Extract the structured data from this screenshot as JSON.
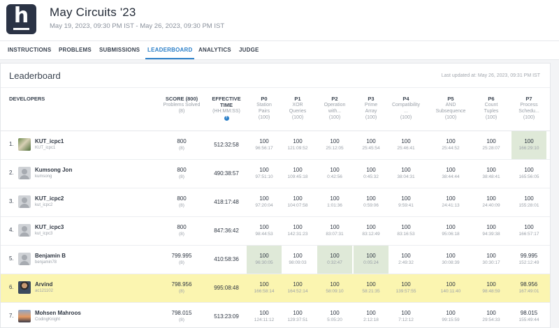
{
  "contest": {
    "logo_letter": "h",
    "title": "May Circuits '23",
    "dates": "May 19, 2023, 09:30 PM IST - May 26, 2023, 09:30 PM IST"
  },
  "tabs": [
    "INSTRUCTIONS",
    "PROBLEMS",
    "SUBMISSIONS",
    "LEADERBOARD",
    "ANALYTICS",
    "JUDGE"
  ],
  "active_tab": "LEADERBOARD",
  "leaderboard": {
    "title": "Leaderboard",
    "updated": "Last updated at: May 26, 2023, 09:31 PM IST",
    "developers_header": "DEVELOPERS",
    "score_header": {
      "title": "SCORE (800)",
      "sub": "Problems Solved",
      "sub2": "(8)"
    },
    "eff_header": {
      "title1": "EFFECTIVE",
      "title2": "TIME",
      "sub": "(HH:MM:SS)"
    },
    "problems": [
      {
        "code": "P0",
        "l1": "Station",
        "l2": "Pairs",
        "max": "(100)"
      },
      {
        "code": "P1",
        "l1": "XOR",
        "l2": "Queries",
        "max": "(100)"
      },
      {
        "code": "P2",
        "l1": "Operation",
        "l2": "with...",
        "max": "(100)"
      },
      {
        "code": "P3",
        "l1": "Prime",
        "l2": "Array",
        "max": "(100)"
      },
      {
        "code": "P4",
        "l1": "Compatibility",
        "l2": "...",
        "max": "(100)"
      },
      {
        "code": "P5",
        "l1": "AND",
        "l2": "Subsequence",
        "max": "(100)"
      },
      {
        "code": "P6",
        "l1": "Count",
        "l2": "Tuples",
        "max": "(100)"
      },
      {
        "code": "P7",
        "l1": "Process",
        "l2": "Schedu...",
        "max": "(100)"
      }
    ],
    "rows": [
      {
        "rank": "1.",
        "name": "KUT_icpc1",
        "handle": "KUT_icpc1",
        "avatar": "img1",
        "score": "800",
        "solved": "(8)",
        "eff": "512:32:58",
        "cells": [
          [
            "100",
            "96:56:17"
          ],
          [
            "100",
            "121:09:52"
          ],
          [
            "100",
            "25:12:05"
          ],
          [
            "100",
            "25:45:54"
          ],
          [
            "100",
            "25:46:41"
          ],
          [
            "100",
            "25:44:52"
          ],
          [
            "100",
            "25:28:07"
          ],
          [
            "100",
            "166:29:10"
          ]
        ],
        "first": [
          7
        ],
        "highlight": false
      },
      {
        "rank": "2.",
        "name": "Kumsong Jon",
        "handle": "kumsong",
        "avatar": "default",
        "score": "800",
        "solved": "(8)",
        "eff": "490:38:57",
        "cells": [
          [
            "100",
            "97:51:10"
          ],
          [
            "100",
            "109:45:18"
          ],
          [
            "100",
            "0:42:56"
          ],
          [
            "100",
            "0:45:32"
          ],
          [
            "100",
            "38:04:31"
          ],
          [
            "100",
            "38:44:44"
          ],
          [
            "100",
            "38:48:41"
          ],
          [
            "100",
            "165:56:05"
          ]
        ],
        "first": [],
        "highlight": false
      },
      {
        "rank": "3.",
        "name": "KUT_icpc2",
        "handle": "kut_icpc2",
        "avatar": "default",
        "score": "800",
        "solved": "(8)",
        "eff": "418:17:48",
        "cells": [
          [
            "100",
            "97:20:04"
          ],
          [
            "100",
            "104:07:58"
          ],
          [
            "100",
            "1:01:36"
          ],
          [
            "100",
            "0:59:06"
          ],
          [
            "100",
            "9:59:41"
          ],
          [
            "100",
            "24:41:13"
          ],
          [
            "100",
            "24:40:09"
          ],
          [
            "100",
            "155:28:01"
          ]
        ],
        "first": [],
        "highlight": false
      },
      {
        "rank": "4.",
        "name": "KUT_icpc3",
        "handle": "kut_icpc3",
        "avatar": "default",
        "score": "800",
        "solved": "(8)",
        "eff": "847:36:42",
        "cells": [
          [
            "100",
            "98:44:53"
          ],
          [
            "100",
            "142:31:23"
          ],
          [
            "100",
            "83:07:31"
          ],
          [
            "100",
            "83:12:49"
          ],
          [
            "100",
            "83:16:53"
          ],
          [
            "100",
            "95:06:18"
          ],
          [
            "100",
            "94:39:38"
          ],
          [
            "100",
            "166:57:17"
          ]
        ],
        "first": [],
        "highlight": false
      },
      {
        "rank": "5.",
        "name": "Benjamin B",
        "handle": "benjamin78",
        "avatar": "default",
        "score": "799.995",
        "solved": "(8)",
        "eff": "410:58:36",
        "cells": [
          [
            "100",
            "96:30:05"
          ],
          [
            "100",
            "98:09:03"
          ],
          [
            "100",
            "0:32:47"
          ],
          [
            "100",
            "0:05:24"
          ],
          [
            "100",
            "2:49:32"
          ],
          [
            "100",
            "30:08:39"
          ],
          [
            "100",
            "30:30:17"
          ],
          [
            "99.995",
            "152:12:49"
          ]
        ],
        "first": [
          0,
          2,
          3
        ],
        "highlight": false
      },
      {
        "rank": "6.",
        "name": "Arvind",
        "handle": "ac121102",
        "avatar": "img2",
        "score": "798.956",
        "solved": "(8)",
        "eff": "995:08:48",
        "cells": [
          [
            "100",
            "166:58:14"
          ],
          [
            "100",
            "164:52:14"
          ],
          [
            "100",
            "58:09:10"
          ],
          [
            "100",
            "58:21:35"
          ],
          [
            "100",
            "139:57:55"
          ],
          [
            "100",
            "140:11:40"
          ],
          [
            "100",
            "98:48:59"
          ],
          [
            "98.956",
            "167:49:01"
          ]
        ],
        "first": [],
        "highlight": true
      },
      {
        "rank": "7.",
        "name": "Mohsen Mahroos",
        "handle": "CodingKnight",
        "avatar": "img3",
        "score": "798.015",
        "solved": "(8)",
        "eff": "513:23:09",
        "cells": [
          [
            "100",
            "124:11:12"
          ],
          [
            "100",
            "129:37:51"
          ],
          [
            "100",
            "5:05:20"
          ],
          [
            "100",
            "2:12:18"
          ],
          [
            "100",
            "7:12:12"
          ],
          [
            "100",
            "99:15:59"
          ],
          [
            "100",
            "29:54:33"
          ],
          [
            "98.015",
            "155:49:44"
          ]
        ],
        "first": [],
        "highlight": false
      }
    ]
  }
}
